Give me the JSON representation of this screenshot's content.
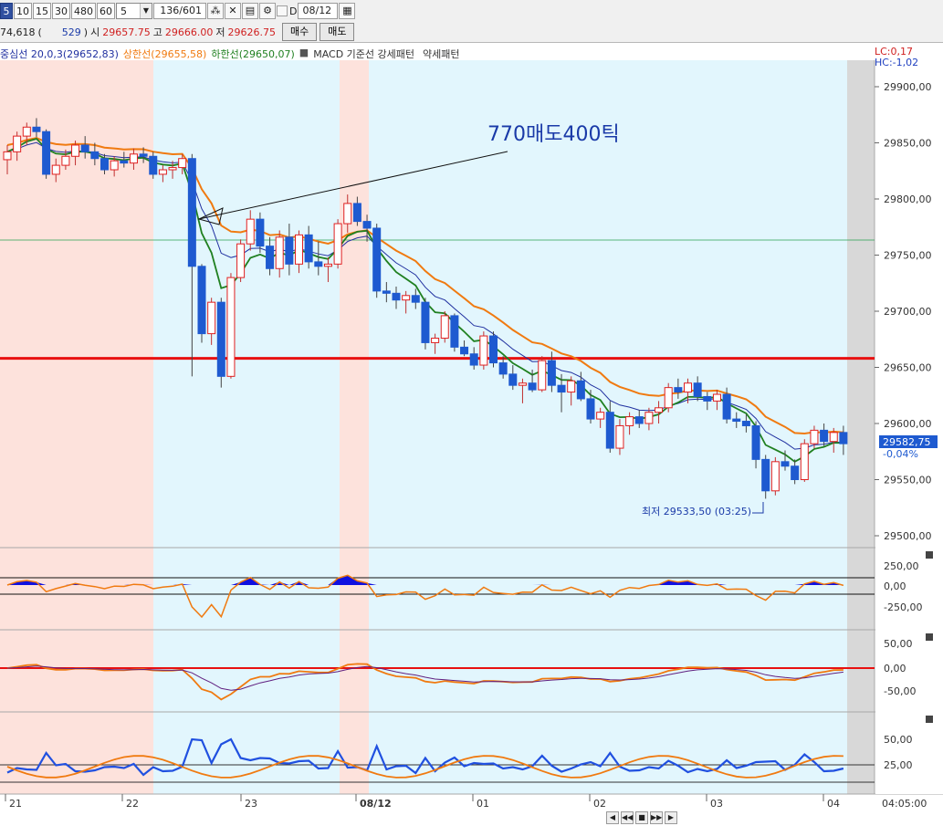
{
  "toolbar": {
    "periods": [
      "5",
      "10",
      "15",
      "30",
      "480",
      "60"
    ],
    "selected_period": "5",
    "interval_value": "5",
    "count_display": "136/601",
    "checkbox_label": "D",
    "date_value": "08/12",
    "price_prefix": "74,618",
    "volume_value": "529",
    "open_label": "시",
    "open_value": "29657.75",
    "high_label": "고",
    "high_value": "29666.00",
    "low_label": "저",
    "low_value": "29626.75",
    "buy_label": "매수",
    "sell_label": "매도"
  },
  "legend": {
    "center": "중심선 20,0,3(29652,83)",
    "upper": "상한선(29655,58)",
    "lower": "하한선(29650,07)",
    "macd": "MACD 기준선 강세패턴",
    "weak": "약세패턴"
  },
  "corner": {
    "lc": "LC:0,17",
    "hc": "HC:-1,02"
  },
  "annotation": {
    "text": "770매도400틱"
  },
  "low_marker": {
    "text": "최저 29533,50 (03:25)"
  },
  "current": {
    "price": "29582,75",
    "change": "-0,04%"
  },
  "price_axis": [
    "29900,00",
    "29850,00",
    "29800,00",
    "29750,00",
    "29700,00",
    "29650,00",
    "29600,00",
    "29550,00",
    "29500,00"
  ],
  "panel1_axis": [
    "250,00",
    "0,00",
    "-250,00"
  ],
  "panel2_axis": [
    "50,00",
    "0,00",
    "-50,00"
  ],
  "panel3_axis": [
    "50,00",
    "25,00"
  ],
  "time_axis": [
    "21",
    "22",
    "23",
    "08/12",
    "01",
    "02",
    "03",
    "04",
    "04:05:00"
  ],
  "colors": {
    "sell_zone": "#fde2dc",
    "buy_zone": "#e2f6fd",
    "bull": "#e02020",
    "bear": "#1e5ad0",
    "upper_band": "#f07a10",
    "center_band": "#2030a0",
    "lower_band": "#208020",
    "support": "#e81010"
  },
  "candles": [
    [
      29835,
      29848,
      29822,
      29842
    ],
    [
      29842,
      29860,
      29834,
      29856
    ],
    [
      29856,
      29868,
      29848,
      29864
    ],
    [
      29864,
      29872,
      29855,
      29860
    ],
    [
      29860,
      29862,
      29818,
      29822
    ],
    [
      29822,
      29836,
      29815,
      29830
    ],
    [
      29830,
      29844,
      29826,
      29838
    ],
    [
      29838,
      29852,
      29830,
      29848
    ],
    [
      29848,
      29856,
      29836,
      29842
    ],
    [
      29842,
      29850,
      29830,
      29836
    ],
    [
      29836,
      29840,
      29822,
      29826
    ],
    [
      29826,
      29838,
      29820,
      29834
    ],
    [
      29834,
      29842,
      29828,
      29832
    ],
    [
      29832,
      29845,
      29826,
      29840
    ],
    [
      29840,
      29846,
      29832,
      29838
    ],
    [
      29838,
      29842,
      29818,
      29822
    ],
    [
      29822,
      29830,
      29815,
      29826
    ],
    [
      29826,
      29834,
      29818,
      29828
    ],
    [
      29828,
      29840,
      29822,
      29836
    ],
    [
      29836,
      29840,
      29642,
      29740
    ],
    [
      29740,
      29742,
      29672,
      29680
    ],
    [
      29680,
      29712,
      29670,
      29708
    ],
    [
      29708,
      29712,
      29632,
      29642
    ],
    [
      29642,
      29734,
      29640,
      29730
    ],
    [
      29730,
      29764,
      29726,
      29760
    ],
    [
      29760,
      29790,
      29754,
      29782
    ],
    [
      29782,
      29788,
      29752,
      29758
    ],
    [
      29758,
      29766,
      29732,
      29738
    ],
    [
      29738,
      29772,
      29730,
      29766
    ],
    [
      29766,
      29778,
      29732,
      29742
    ],
    [
      29742,
      29772,
      29734,
      29768
    ],
    [
      29768,
      29776,
      29738,
      29744
    ],
    [
      29744,
      29762,
      29732,
      29740
    ],
    [
      29740,
      29748,
      29726,
      29742
    ],
    [
      29742,
      29782,
      29738,
      29778
    ],
    [
      29778,
      29804,
      29770,
      29796
    ],
    [
      29796,
      29802,
      29776,
      29780
    ],
    [
      29780,
      29786,
      29762,
      29774
    ],
    [
      29774,
      29778,
      29712,
      29718
    ],
    [
      29718,
      29726,
      29708,
      29716
    ],
    [
      29716,
      29722,
      29702,
      29710
    ],
    [
      29710,
      29718,
      29698,
      29714
    ],
    [
      29714,
      29720,
      29702,
      29708
    ],
    [
      29708,
      29712,
      29666,
      29672
    ],
    [
      29672,
      29680,
      29662,
      29676
    ],
    [
      29676,
      29700,
      29672,
      29696
    ],
    [
      29696,
      29698,
      29664,
      29668
    ],
    [
      29668,
      29674,
      29660,
      29662
    ],
    [
      29662,
      29668,
      29648,
      29652
    ],
    [
      29652,
      29682,
      29648,
      29678
    ],
    [
      29678,
      29682,
      29650,
      29654
    ],
    [
      29654,
      29660,
      29640,
      29644
    ],
    [
      29644,
      29652,
      29630,
      29634
    ],
    [
      29634,
      29640,
      29618,
      29636
    ],
    [
      29636,
      29648,
      29628,
      29630
    ],
    [
      29630,
      29660,
      29628,
      29656
    ],
    [
      29656,
      29664,
      29628,
      29634
    ],
    [
      29634,
      29644,
      29610,
      29628
    ],
    [
      29628,
      29642,
      29616,
      29638
    ],
    [
      29638,
      29646,
      29620,
      29622
    ],
    [
      29622,
      29630,
      29600,
      29604
    ],
    [
      29604,
      29614,
      29596,
      29610
    ],
    [
      29610,
      29620,
      29574,
      29578
    ],
    [
      29578,
      29604,
      29572,
      29598
    ],
    [
      29598,
      29610,
      29590,
      29606
    ],
    [
      29606,
      29612,
      29596,
      29600
    ],
    [
      29600,
      29614,
      29594,
      29610
    ],
    [
      29610,
      29620,
      29600,
      29614
    ],
    [
      29614,
      29636,
      29610,
      29632
    ],
    [
      29632,
      29640,
      29622,
      29628
    ],
    [
      29628,
      29640,
      29618,
      29636
    ],
    [
      29636,
      29642,
      29620,
      29624
    ],
    [
      29624,
      29628,
      29612,
      29620
    ],
    [
      29620,
      29630,
      29612,
      29626
    ],
    [
      29626,
      29632,
      29600,
      29604
    ],
    [
      29604,
      29610,
      29596,
      29602
    ],
    [
      29602,
      29608,
      29592,
      29598
    ],
    [
      29598,
      29602,
      29560,
      29568
    ],
    [
      29568,
      29572,
      29533,
      29540
    ],
    [
      29540,
      29570,
      29536,
      29566
    ],
    [
      29566,
      29576,
      29558,
      29562
    ],
    [
      29562,
      29568,
      29546,
      29550
    ],
    [
      29550,
      29586,
      29548,
      29582
    ],
    [
      29582,
      29598,
      29578,
      29594
    ],
    [
      29594,
      29600,
      29580,
      29584
    ],
    [
      29584,
      29596,
      29574,
      29592
    ],
    [
      29592,
      29598,
      29572,
      29582
    ]
  ]
}
